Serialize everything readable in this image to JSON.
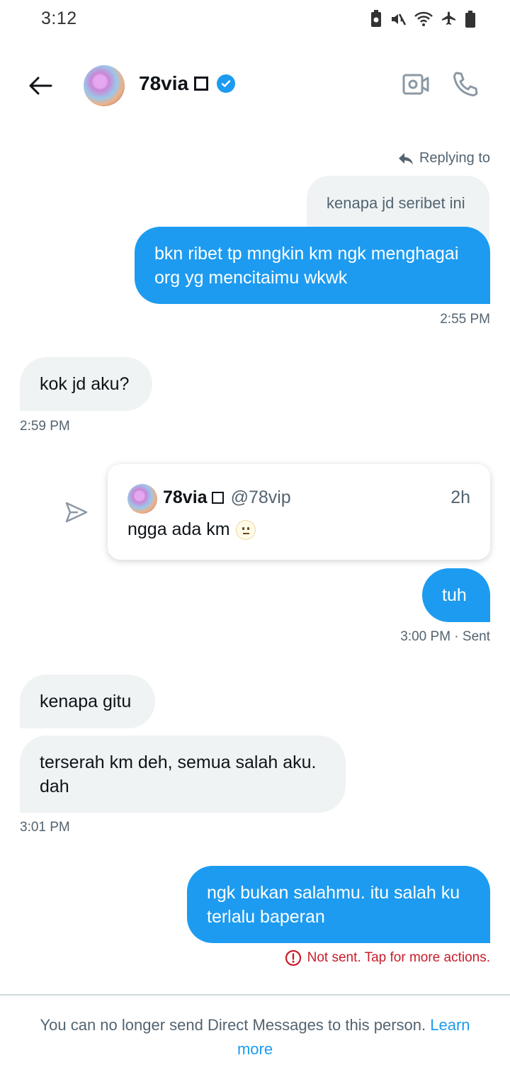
{
  "status_bar": {
    "time": "3:12"
  },
  "header": {
    "name": "78via"
  },
  "conversation": {
    "replying_to_label": "Replying to",
    "quoted_reply": "kenapa jd seribet ini",
    "messages": [
      {
        "text": "bkn ribet tp mngkin km ngk menghagai org yg mencitaimu wkwk",
        "direction": "sent"
      },
      {
        "text": "kok jd aku?",
        "direction": "received"
      },
      {
        "text": "tuh",
        "direction": "sent"
      },
      {
        "text": "kenapa gitu",
        "direction": "received"
      },
      {
        "text": "terserah km deh, semua salah aku. dah",
        "direction": "received"
      },
      {
        "text": "ngk bukan salahmu. itu salah ku terlalu baperan",
        "direction": "sent"
      }
    ],
    "timestamps": [
      "2:55 PM",
      "2:59 PM",
      "3:00 PM · Sent",
      "3:01 PM"
    ],
    "shared_tweet": {
      "name": "78via",
      "handle": "@78vip",
      "time": "2h",
      "text": "ngga ada km"
    },
    "error_text": "Not sent. Tap for more actions."
  },
  "footer": {
    "text": "You can no longer send Direct Messages to this person.",
    "link": "Learn more"
  },
  "colors": {
    "accent": "#1d9bf0",
    "received_bubble": "#eff3f4",
    "error": "#c91c2a"
  },
  "icons": [
    "back-arrow-icon",
    "verified-badge-icon",
    "video-call-icon",
    "phone-icon",
    "reply-icon",
    "share-icon",
    "error-icon"
  ]
}
